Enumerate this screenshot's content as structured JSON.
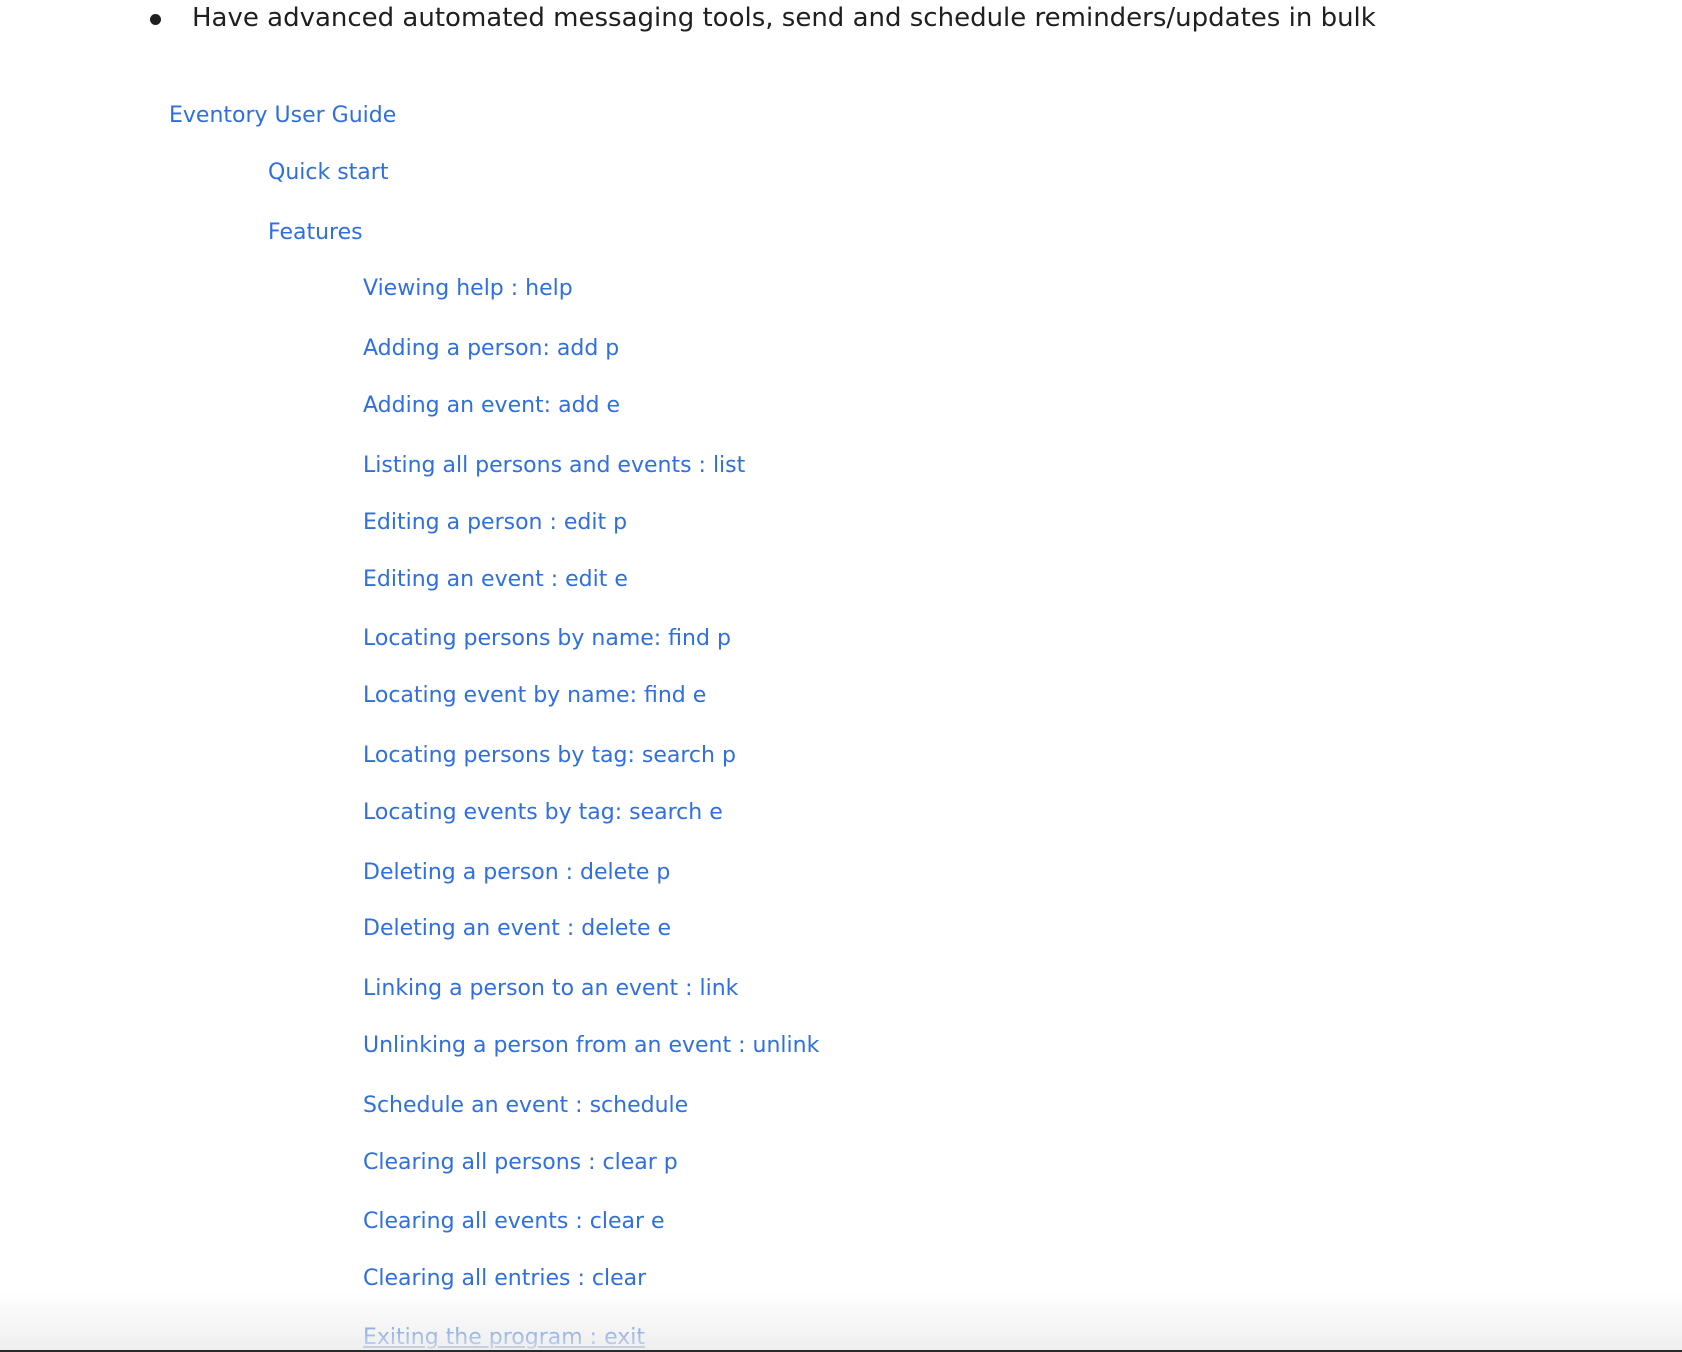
{
  "bullet": {
    "text": "Have advanced automated messaging tools, send and schedule reminders/updates in bulk"
  },
  "toc": {
    "title": "Eventory User Guide",
    "quick_start": "Quick start",
    "features": "Features",
    "feature_items": [
      "Viewing help : help",
      "Adding a person: add p",
      "Adding an event: add e",
      "Listing all persons and events : list",
      "Editing a person : edit p",
      "Editing an event : edit e",
      "Locating persons by name: find p",
      "Locating event by name: find e",
      "Locating persons by tag: search p",
      "Locating events by tag: search e",
      "Deleting a person : delete p",
      "Deleting an event : delete e",
      "Linking a person to an event : link",
      "Unlinking a person from an event : unlink",
      "Schedule an event : schedule",
      "Clearing all persons : clear p",
      "Clearing all events : clear e",
      "Clearing all entries : clear",
      "Exiting the program : exit"
    ]
  },
  "colors": {
    "link": "#2f6fe0",
    "text": "#1f1f1f",
    "background": "#ffffff"
  }
}
